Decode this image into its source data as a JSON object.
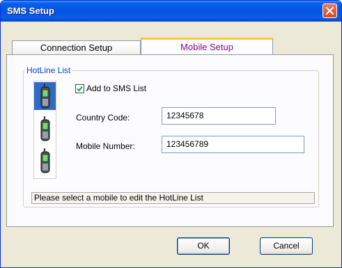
{
  "window": {
    "title": "SMS Setup"
  },
  "icons": {
    "close": "close-icon",
    "phone": "mobile-phone-icon",
    "check": "checkmark-icon"
  },
  "colors": {
    "titlebar": "#0554e3",
    "active_tab_accent": "#ffc73c",
    "active_tab_text": "#7f0d8c",
    "legend_text": "#0046d5",
    "selection": "#316ac5"
  },
  "tabs": [
    {
      "label": "Connection Setup",
      "active": false
    },
    {
      "label": "Mobile Setup",
      "active": true
    }
  ],
  "hotline": {
    "group_label": "HotLine List",
    "phones": [
      {
        "name": "phone-1",
        "selected": true
      },
      {
        "name": "phone-2",
        "selected": false
      },
      {
        "name": "phone-3",
        "selected": false
      }
    ],
    "add_checkbox": {
      "label": "Add to SMS List",
      "checked": true
    },
    "country_code": {
      "label": "Country Code:",
      "value": "12345678"
    },
    "mobile_number": {
      "label": "Mobile Number:",
      "value": "123456789"
    },
    "status": "Please select a mobile to edit the HotLine List"
  },
  "buttons": {
    "ok": "OK",
    "cancel": "Cancel"
  }
}
